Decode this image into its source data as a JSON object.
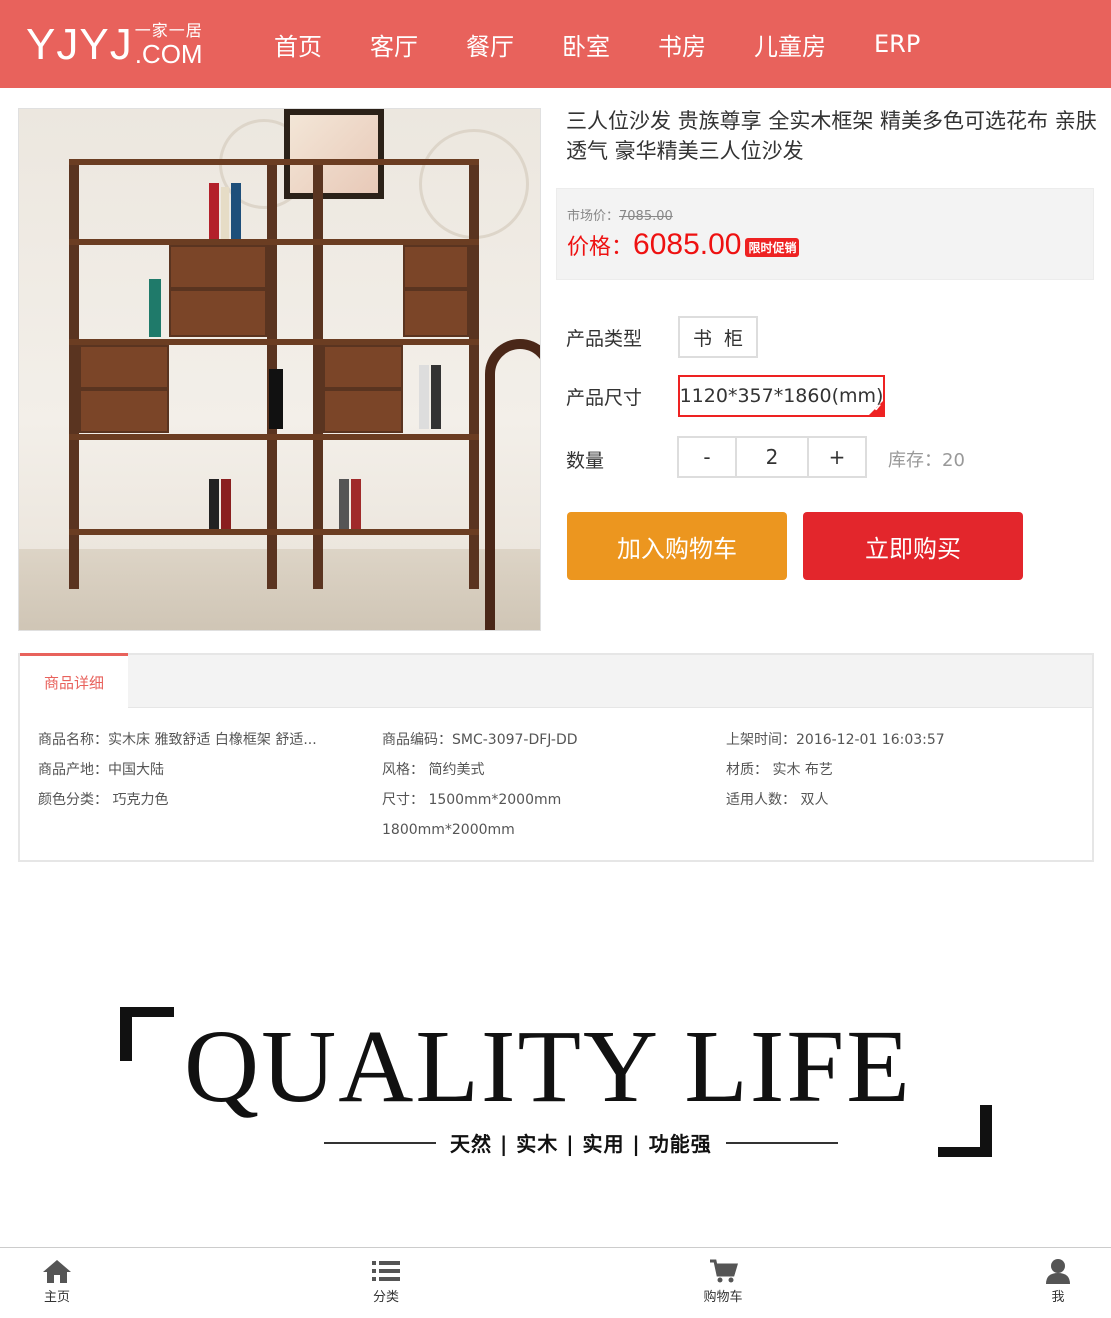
{
  "header": {
    "logo_main": "YJYJ",
    "logo_cn": "一家一居",
    "logo_com": ".COM",
    "nav": [
      "首页",
      "客厅",
      "餐厅",
      "卧室",
      "书房",
      "儿童房",
      "ERP"
    ]
  },
  "product": {
    "title": "三人位沙发 贵族尊享 全实木框架 精美多色可选花布 亲肤透气 豪华精美三人位沙发",
    "market_label": "市场价：",
    "market_price": "7085.00",
    "price_label": "价格：",
    "price": "6085.00",
    "promo_badge": "限时促销",
    "type_label": "产品类型",
    "type_value": "书  柜",
    "size_label": "产品尺寸",
    "size_value": "1120*357*1860(mm)",
    "qty_label": "数量",
    "qty_minus": "-",
    "qty_value": "2",
    "qty_plus": "+",
    "stock": "库存：20",
    "add_cart": "加入购物车",
    "buy_now": "立即购买"
  },
  "detail": {
    "tab": "商品详细",
    "col1": [
      "商品名称：实木床 雅致舒适 白橡框架 舒适...",
      "商品产地：中国大陆",
      "颜色分类： 巧克力色"
    ],
    "col2": [
      "商品编码：SMC-3097-DFJ-DD",
      "风格： 简约美式",
      "尺寸： 1500mm*2000mm",
      "1800mm*2000mm"
    ],
    "col3": [
      "上架时间：2016-12-01 16:03:57",
      "材质： 实木 布艺",
      "适用人数： 双人"
    ]
  },
  "banner": {
    "title": "QUALITY LIFE",
    "subtitle": "天然 | 实木 | 实用 | 功能强"
  },
  "bottom_nav": [
    {
      "label": "主页",
      "icon": "home-icon"
    },
    {
      "label": "分类",
      "icon": "list-icon"
    },
    {
      "label": "购物车",
      "icon": "cart-icon"
    },
    {
      "label": "我",
      "icon": "user-icon"
    }
  ],
  "colors": {
    "brand": "#e8625c",
    "price": "#e11111",
    "cart_button": "#ec961f",
    "buy_button": "#e3262c"
  }
}
